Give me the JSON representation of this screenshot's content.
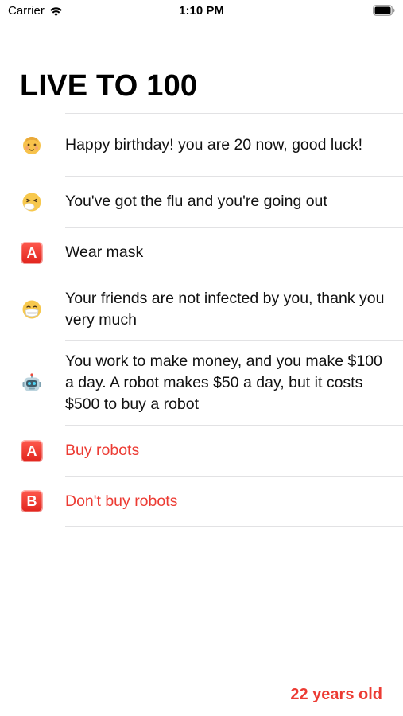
{
  "status_bar": {
    "carrier": "Carrier",
    "time": "1:10 PM",
    "wifi_icon": "wifi-icon",
    "battery_icon": "battery-icon"
  },
  "title": "LIVE TO 100",
  "items": [
    {
      "icon": "baby-face-emoji",
      "text": "Happy birthday! you are 20 now, good luck!",
      "kind": "event"
    },
    {
      "icon": "sneezing-face-emoji",
      "text": "You've got the flu and you're going out",
      "kind": "event"
    },
    {
      "icon": "letter-a-button",
      "badge": "A",
      "text": "Wear mask",
      "kind": "chosen"
    },
    {
      "icon": "face-with-mask-emoji",
      "text": "Your friends are not infected by you, thank you very much",
      "kind": "event"
    },
    {
      "icon": "robot-face-emoji",
      "text": "You work to make money, and you make $100 a day. A robot makes $50 a day, but it costs $500 to buy a robot",
      "kind": "event"
    },
    {
      "icon": "letter-a-button",
      "badge": "A",
      "text": "Buy robots",
      "kind": "option"
    },
    {
      "icon": "letter-b-button",
      "badge": "B",
      "text": "Don't buy robots",
      "kind": "option"
    }
  ],
  "age_label": "22 years old",
  "colors": {
    "accent": "#ec3b33",
    "separator": "#e2e2e4",
    "text": "#000000"
  }
}
